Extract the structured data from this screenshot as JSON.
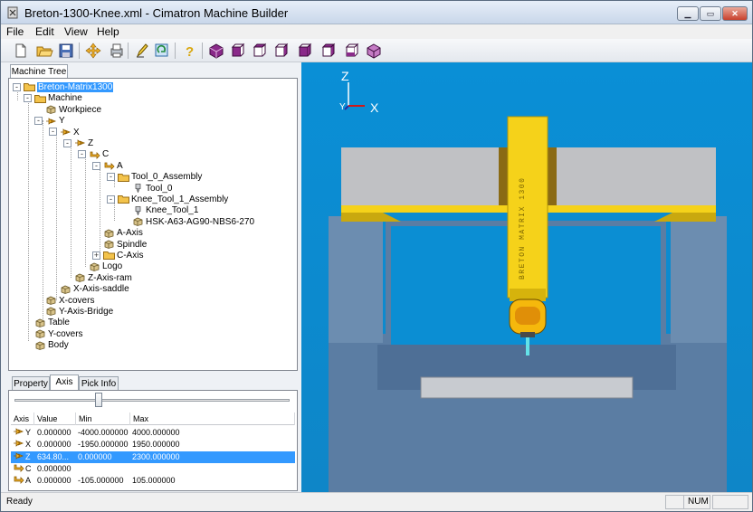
{
  "window": {
    "title": "Breton-1300-Knee.xml - Cimatron Machine Builder",
    "minimize": "0",
    "maximize": "1",
    "close": "x"
  },
  "menu": [
    "File",
    "Edit",
    "View",
    "Help"
  ],
  "toolbar": [
    "new-icon",
    "open-icon",
    "save-icon",
    "move-icon",
    "print-icon",
    "pencil-icon",
    "refresh-icon",
    "help-icon",
    "view-iso-icon",
    "view-front-icon",
    "view-back-icon",
    "view-left-icon",
    "view-right-icon",
    "view-top-icon",
    "view-bottom-icon"
  ],
  "left": {
    "tree_tab": "Machine Tree",
    "tree": [
      {
        "label": "Breton-Matrix1300",
        "exp": "-",
        "icon": "folder",
        "selected": true
      },
      {
        "label": "Machine",
        "exp": "-",
        "icon": "folder"
      },
      {
        "label": "Workpiece",
        "icon": "cube"
      },
      {
        "label": "Y",
        "exp": "-",
        "icon": "axis-arrow"
      },
      {
        "label": "X",
        "exp": "-",
        "icon": "axis-arrow"
      },
      {
        "label": "Z",
        "exp": "-",
        "icon": "axis-arrow"
      },
      {
        "label": "C",
        "exp": "-",
        "icon": "rotary"
      },
      {
        "label": "A",
        "exp": "-",
        "icon": "rotary"
      },
      {
        "label": "Tool_0_Assembly",
        "exp": "-",
        "icon": "folder"
      },
      {
        "label": "Tool_0",
        "icon": "tool"
      },
      {
        "label": "Knee_Tool_1_Assembly",
        "exp": "-",
        "icon": "folder"
      },
      {
        "label": "Knee_Tool_1",
        "icon": "tool"
      },
      {
        "label": "HSK-A63-AG90-NBS6-270",
        "icon": "cube"
      },
      {
        "label": "A-Axis",
        "icon": "cube"
      },
      {
        "label": "Spindle",
        "icon": "cube"
      },
      {
        "label": "C-Axis",
        "exp": "+",
        "icon": "folder"
      },
      {
        "label": "Logo",
        "icon": "cube"
      },
      {
        "label": "Z-Axis-ram",
        "icon": "cube"
      },
      {
        "label": "X-Axis-saddle",
        "icon": "cube"
      },
      {
        "label": "X-covers",
        "icon": "cube"
      },
      {
        "label": "Y-Axis-Bridge",
        "icon": "cube"
      },
      {
        "label": "Table",
        "icon": "cube"
      },
      {
        "label": "Y-covers",
        "icon": "cube"
      },
      {
        "label": "Body",
        "icon": "cube"
      }
    ],
    "tabs": [
      "Property",
      "Axis",
      "Pick Info"
    ],
    "active_tab": "Axis",
    "slider_value": 0.3,
    "columns": [
      "Axis",
      "Value",
      "Min",
      "Max"
    ],
    "rows": [
      {
        "axis": "Y",
        "value": "0.000000",
        "min": "-4000.000000",
        "max": "4000.000000",
        "icon": "axis-arrow"
      },
      {
        "axis": "X",
        "value": "0.000000",
        "min": "-1950.000000",
        "max": "1950.000000",
        "icon": "axis-arrow"
      },
      {
        "axis": "Z",
        "value": "634.80...",
        "min": "0.000000",
        "max": "2300.000000",
        "icon": "axis-arrow",
        "selected": true
      },
      {
        "axis": "C",
        "value": "0.000000",
        "min": "",
        "max": "",
        "icon": "rotary"
      },
      {
        "axis": "A",
        "value": "0.000000",
        "min": "-105.000000",
        "max": "105.000000",
        "icon": "rotary"
      }
    ]
  },
  "viewport": {
    "axis_z": "Z",
    "axis_y": "Y",
    "axis_x": "X",
    "logo_text": "BRETON MATRIX 1300",
    "background": "#0e92d4",
    "accent": "#f5d21a"
  },
  "status": {
    "text": "Ready",
    "num": "NUM"
  }
}
